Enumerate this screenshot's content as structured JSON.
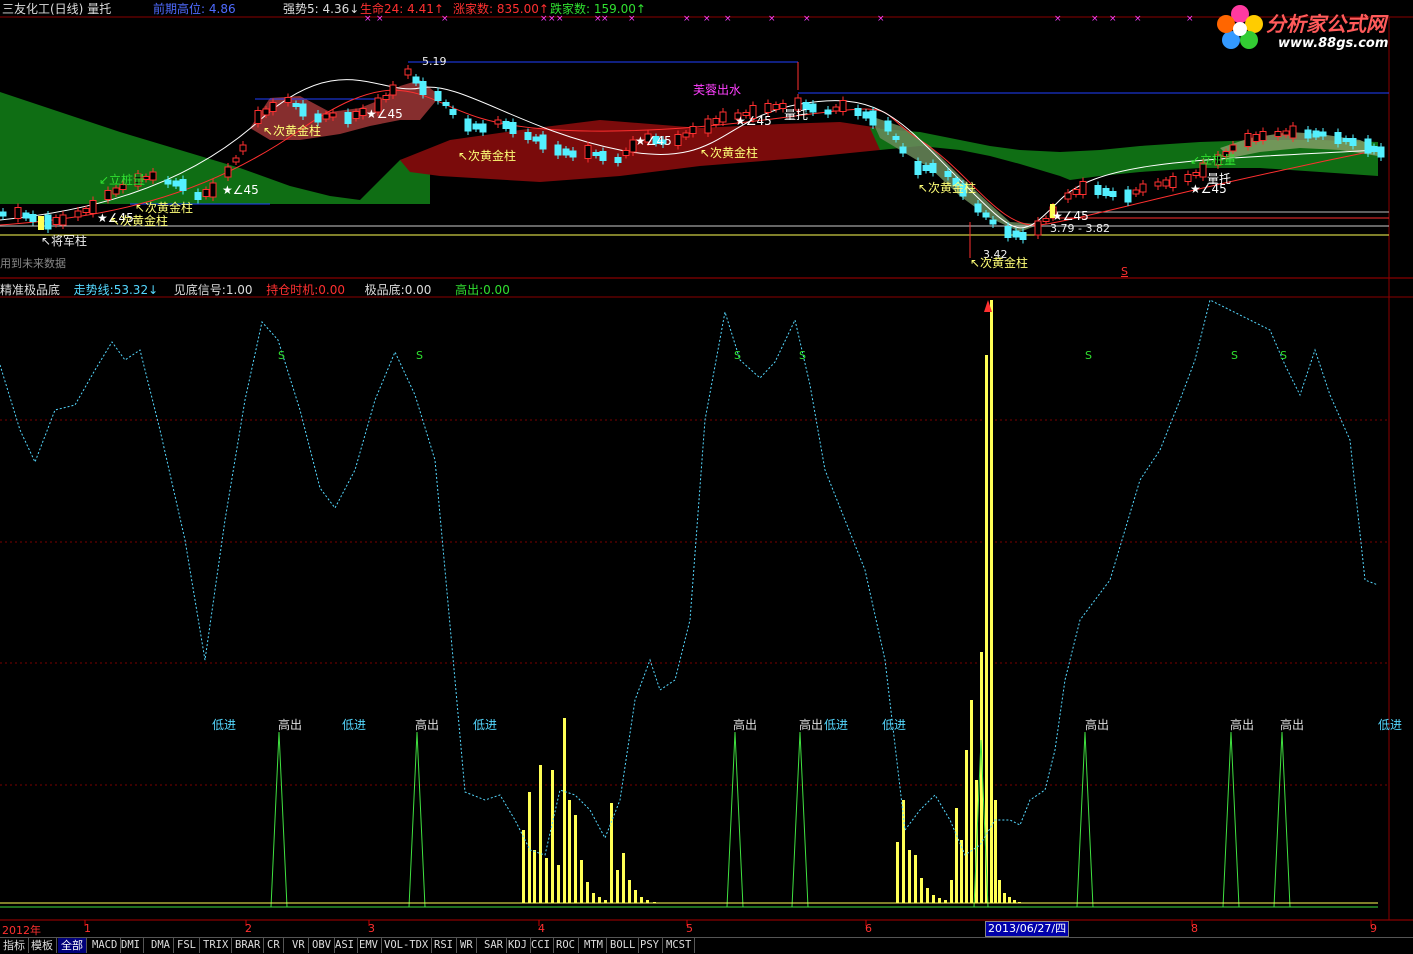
{
  "header": {
    "title": "三友化工(日线)",
    "indicator": "量托",
    "items": [
      {
        "label": "前期高位:",
        "value": "4.86",
        "color": "#4f6bff",
        "arrow": ""
      },
      {
        "label": "强势5:",
        "value": "4.36",
        "color": "#dddddd",
        "arrow": "↓"
      },
      {
        "label": "生命24:",
        "value": "4.41",
        "color": "#ff3030",
        "arrow": "↑"
      },
      {
        "label": "涨家数:",
        "value": "835.00",
        "color": "#ff3030",
        "arrow": "↑"
      },
      {
        "label": "跌家数:",
        "value": "159.00",
        "color": "#30e030",
        "arrow": "↑"
      }
    ]
  },
  "logo": {
    "name": "分析家公式网",
    "url": "www.88gs.com",
    "icon": "flower-logo-icon"
  },
  "price_panel": {
    "labels": {
      "high": "5.19",
      "low": "3.42",
      "range": "3.79 - 3.82",
      "rising": "芙蓉出水",
      "future_data": "用到未来数据",
      "star_angle": "★∠45",
      "gold_bar": "↖次黄金柱",
      "general_bar": "↖将军柱",
      "stand_pillar": "↙立桩量",
      "volume_support": "量托",
      "s_mark": "S"
    }
  },
  "indicator_panel": {
    "legend": [
      {
        "label": "精准极品底",
        "value": "",
        "color": "#dddddd",
        "arrow": ""
      },
      {
        "label": "走势线:",
        "value": "53.32",
        "color": "#55d8ff",
        "arrow": "↓"
      },
      {
        "label": "见底信号:",
        "value": "1.00",
        "color": "#dddddd",
        "arrow": ""
      },
      {
        "label": "持仓时机:",
        "value": "0.00",
        "color": "#ff3030",
        "arrow": ""
      },
      {
        "label": "极品底:",
        "value": "0.00",
        "color": "#dddddd",
        "arrow": ""
      },
      {
        "label": "高出:",
        "value": "0.00",
        "color": "#30e030",
        "arrow": ""
      }
    ],
    "buy_label": "低进",
    "sell_label": "高出",
    "s_label": "S"
  },
  "x_axis": {
    "ticks": [
      "2012年",
      "1",
      "2",
      "3",
      "4",
      "5",
      "6",
      "8",
      "9"
    ],
    "cursor_date": "2013/06/27/四"
  },
  "tabs": [
    "指标",
    "模板",
    "全部",
    "MACD",
    "DMI",
    "DMA",
    "FSL",
    "TRIX",
    "BRAR",
    "CR",
    "VR",
    "OBV",
    "ASI",
    "EMV",
    "VOL-TDX",
    "RSI",
    "WR",
    "SAR",
    "KDJ",
    "CCI",
    "ROC",
    "MTM",
    "BOLL",
    "PSY",
    "MCST"
  ],
  "active_tab": "全部",
  "colors": {
    "background": "#000000",
    "up_candle": "#ff3030",
    "down_candle": "#54f0ff",
    "green_band": "#0f6e14",
    "red_band": "#7a0b0b",
    "trend_line": "#55d8ff",
    "yellow_bar": "#ffff55",
    "green_signal": "#40e040",
    "grid": "#7a0000"
  }
}
